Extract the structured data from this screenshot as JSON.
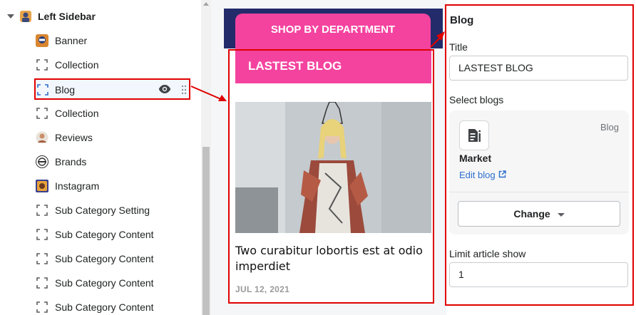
{
  "sidebar": {
    "group_title": "Left Sidebar",
    "items": [
      {
        "label": "Banner",
        "icon": "banner-thumbnail-icon"
      },
      {
        "label": "Collection",
        "icon": "dashed-square-icon"
      },
      {
        "label": "Blog",
        "icon": "dashed-square-icon",
        "active": true
      },
      {
        "label": "Collection",
        "icon": "dashed-square-icon"
      },
      {
        "label": "Reviews",
        "icon": "reviews-thumbnail-icon"
      },
      {
        "label": "Brands",
        "icon": "brands-thumbnail-icon"
      },
      {
        "label": "Instagram",
        "icon": "instagram-thumbnail-icon"
      },
      {
        "label": "Sub Category Setting",
        "icon": "dashed-square-icon"
      },
      {
        "label": "Sub Category Content",
        "icon": "dashed-square-icon"
      },
      {
        "label": "Sub Category Content",
        "icon": "dashed-square-icon"
      },
      {
        "label": "Sub Category Content",
        "icon": "dashed-square-icon"
      },
      {
        "label": "Sub Category Content",
        "icon": "dashed-square-icon"
      }
    ]
  },
  "preview": {
    "shop_button": "SHOP BY DEPARTMENT",
    "blog_heading": "LASTEST BLOG",
    "post_title": "Two curabitur lobortis est at odio imperdiet",
    "post_date": "JUL 12, 2021"
  },
  "settings": {
    "section_title": "Blog",
    "title_label": "Title",
    "title_value": "LASTEST BLOG",
    "select_label": "Select blogs",
    "blog_type": "Blog",
    "blog_name": "Market",
    "edit_link": "Edit blog",
    "change_button": "Change",
    "limit_label": "Limit article show",
    "limit_value": "1"
  },
  "colors": {
    "highlight_red": "#e00000",
    "accent_pink": "#f4439f",
    "navy": "#232b6b",
    "link_blue": "#2c6ecb"
  }
}
